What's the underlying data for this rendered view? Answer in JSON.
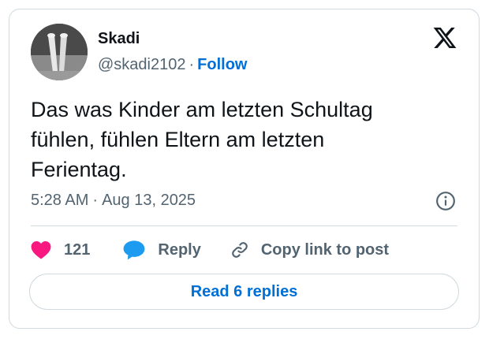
{
  "author": {
    "display_name": "Skadi",
    "handle": "@skadi2102",
    "separator": "·",
    "follow_label": "Follow",
    "avatar_icon": "avatar-photo-legs"
  },
  "brand": {
    "logo_icon": "x-logo-icon"
  },
  "tweet": {
    "text_lines": [
      "Das was Kinder am letzten Schultag",
      "fühlen, fühlen Eltern am letzten",
      "Ferientag."
    ],
    "time": "5:28 AM",
    "separator": "·",
    "date": "Aug 13, 2025"
  },
  "actions": {
    "like_count": "121",
    "reply_label": "Reply",
    "copy_link_label": "Copy link to post",
    "read_replies_label": "Read 6 replies"
  },
  "colors": {
    "like": "#f91880",
    "reply": "#1d9bf0",
    "link": "#006fd6",
    "muted": "#536471",
    "text": "#0f1419",
    "border": "#cfd9de"
  }
}
